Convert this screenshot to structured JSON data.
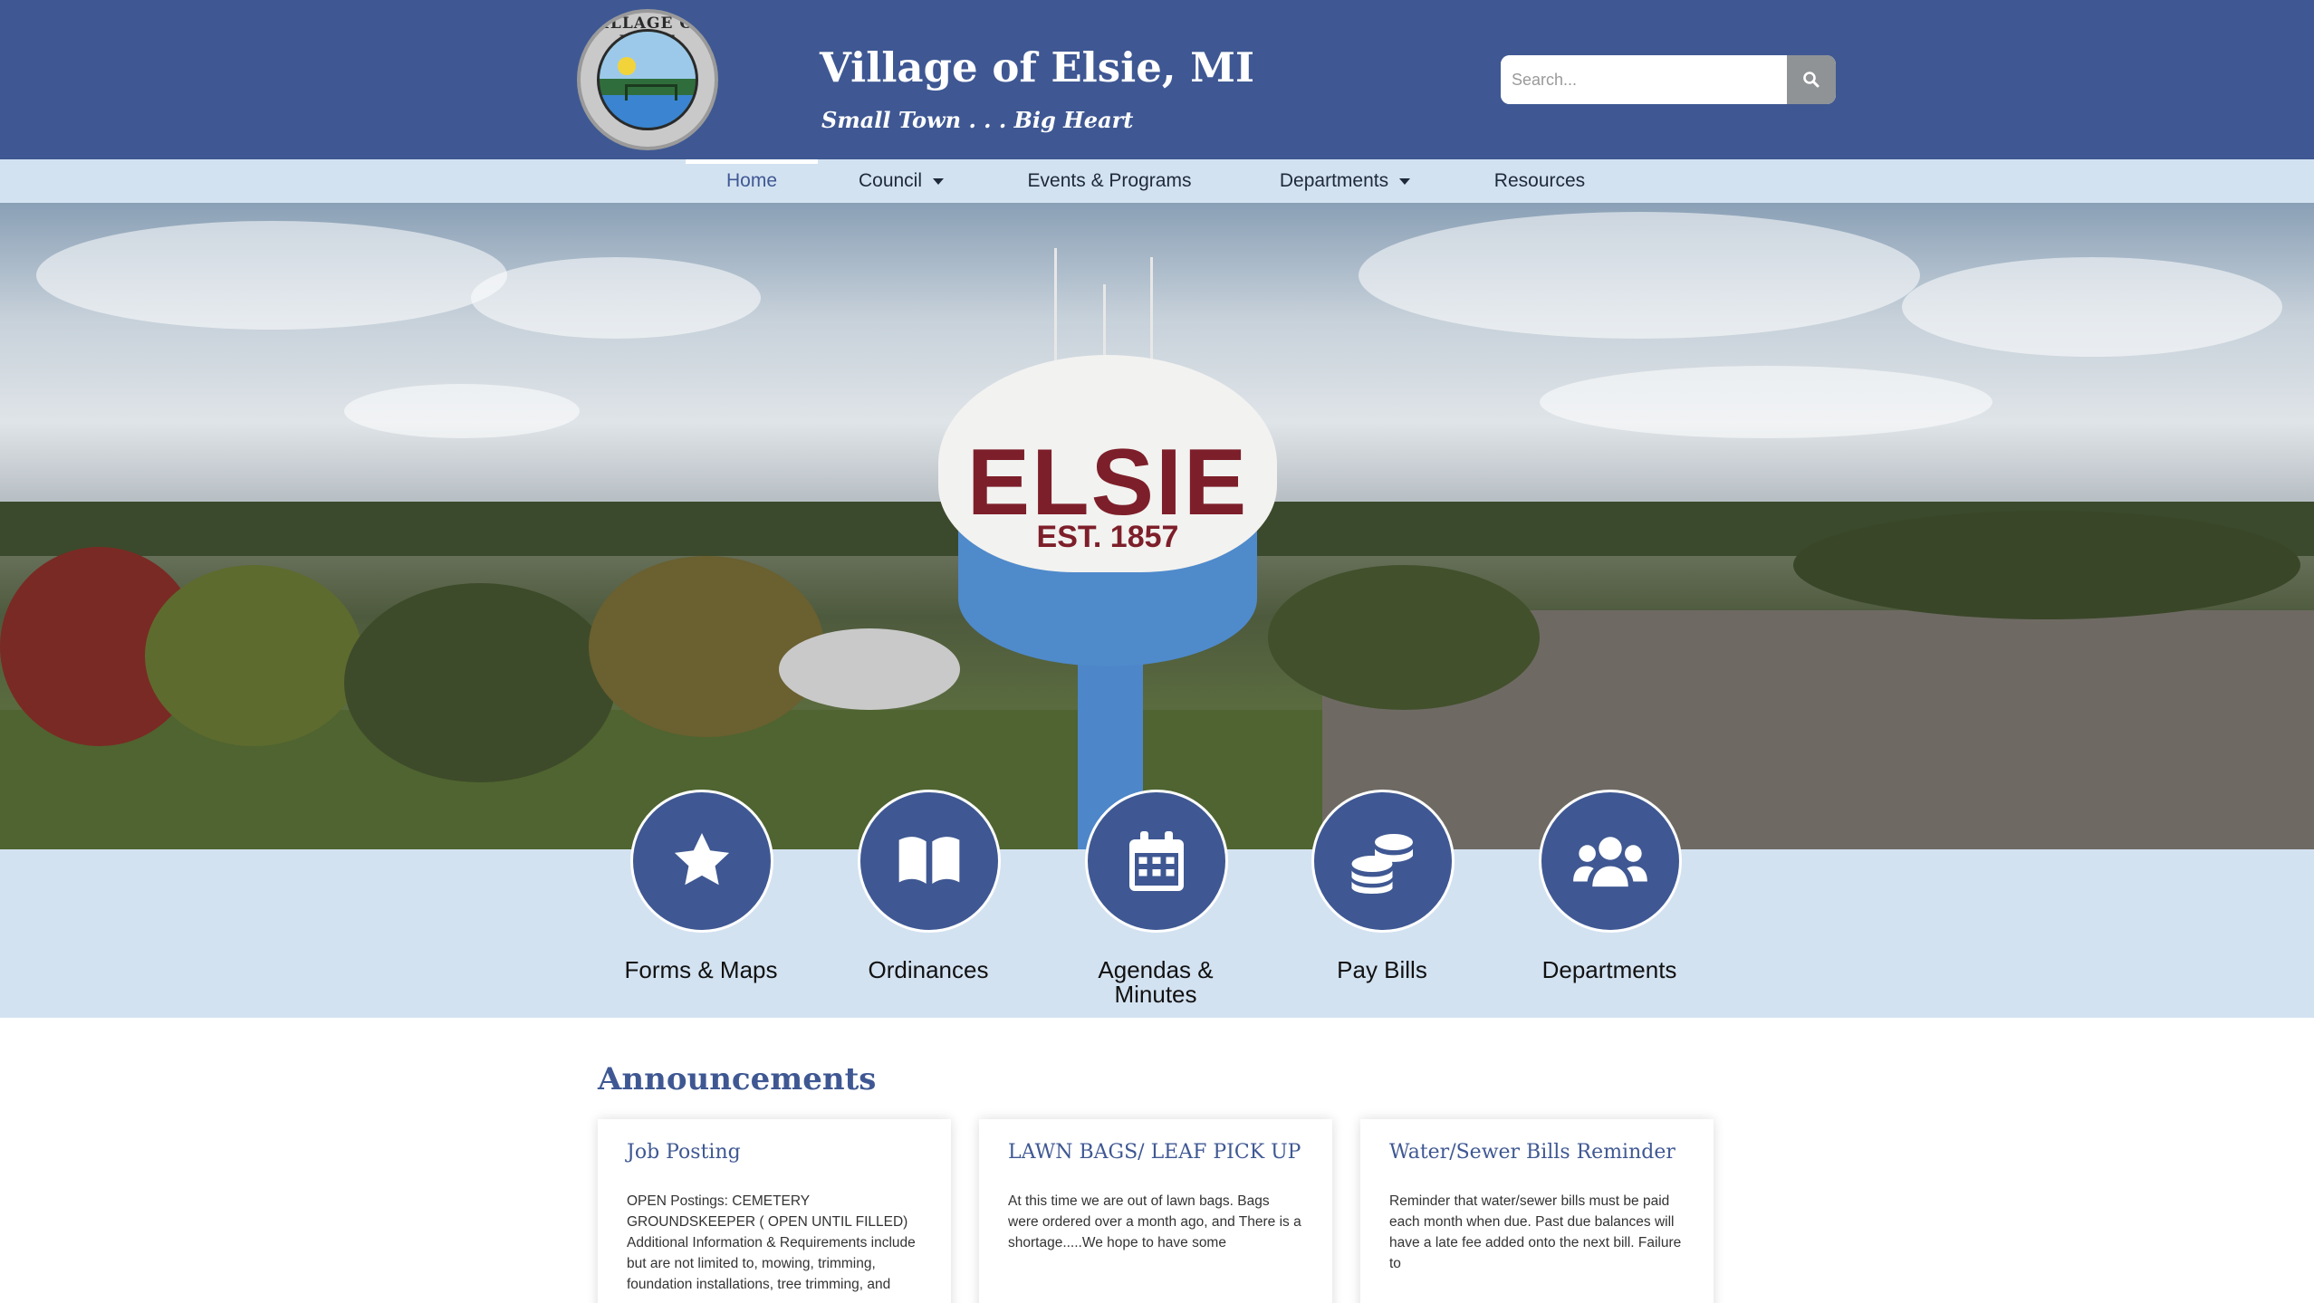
{
  "header": {
    "logo_text": "VILLAGE OF ELSIE",
    "title": "Village of Elsie, MI",
    "tagline": "Small Town . . . Big Heart",
    "search": {
      "placeholder": "Search..."
    }
  },
  "nav": {
    "items": [
      {
        "label": "Home",
        "active": true,
        "has_dropdown": false
      },
      {
        "label": "Council",
        "active": false,
        "has_dropdown": true
      },
      {
        "label": "Events & Programs",
        "active": false,
        "has_dropdown": false
      },
      {
        "label": "Departments",
        "active": false,
        "has_dropdown": true
      },
      {
        "label": "Resources",
        "active": false,
        "has_dropdown": false
      }
    ]
  },
  "hero": {
    "tower_name": "ELSIE",
    "tower_est": "EST. 1857"
  },
  "quick_links": [
    {
      "label": "Forms & Maps",
      "icon": "star-icon"
    },
    {
      "label": "Ordinances",
      "icon": "book-icon"
    },
    {
      "label": "Agendas & Minutes",
      "icon": "calendar-icon"
    },
    {
      "label": "Pay Bills",
      "icon": "coins-icon"
    },
    {
      "label": "Departments",
      "icon": "users-icon"
    }
  ],
  "announcements": {
    "heading": "Announcements",
    "cards": [
      {
        "title": "Job Posting",
        "excerpt": "OPEN Postings: CEMETERY GROUNDSKEEPER ( OPEN UNTIL FILLED)  Additional Information & Requirements include but are not limited to, mowing, trimming, foundation installations, tree trimming, and"
      },
      {
        "title": "LAWN BAGS/ LEAF PICK UP",
        "excerpt": "At this time we are out of lawn bags. Bags were ordered over a month ago, and There is a shortage.....We hope to have some"
      },
      {
        "title": "Water/Sewer Bills Reminder",
        "excerpt": "Reminder that water/sewer bills must be paid each month when due. Past due balances will have a late fee added onto the next bill. Failure to"
      }
    ]
  },
  "colors": {
    "primary": "#3f5893",
    "nav_bg": "#d3e2f1",
    "tower_text": "#7d1f2a"
  }
}
